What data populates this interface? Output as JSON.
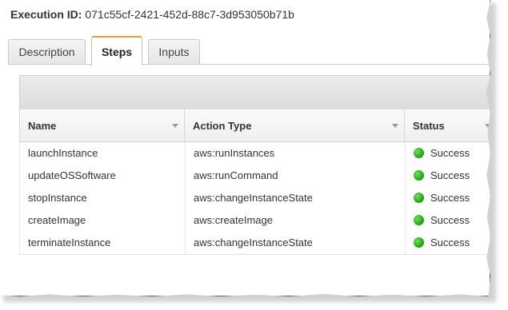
{
  "execution": {
    "label": "Execution ID:",
    "id": "071c55cf-2421-452d-88c7-3d953050b71b"
  },
  "tabs": [
    {
      "label": "Description",
      "active": false
    },
    {
      "label": "Steps",
      "active": true
    },
    {
      "label": "Inputs",
      "active": false
    }
  ],
  "table": {
    "columns": [
      "Name",
      "Action Type",
      "Status"
    ],
    "rows": [
      {
        "name": "launchInstance",
        "action": "aws:runInstances",
        "status": "Success"
      },
      {
        "name": "updateOSSoftware",
        "action": "aws:runCommand",
        "status": "Success"
      },
      {
        "name": "stopInstance",
        "action": "aws:changeInstanceState",
        "status": "Success"
      },
      {
        "name": "createImage",
        "action": "aws:createImage",
        "status": "Success"
      },
      {
        "name": "terminateInstance",
        "action": "aws:changeInstanceState",
        "status": "Success"
      }
    ]
  },
  "colors": {
    "active_tab_accent": "#f0a020",
    "success": "#2aa51c"
  }
}
